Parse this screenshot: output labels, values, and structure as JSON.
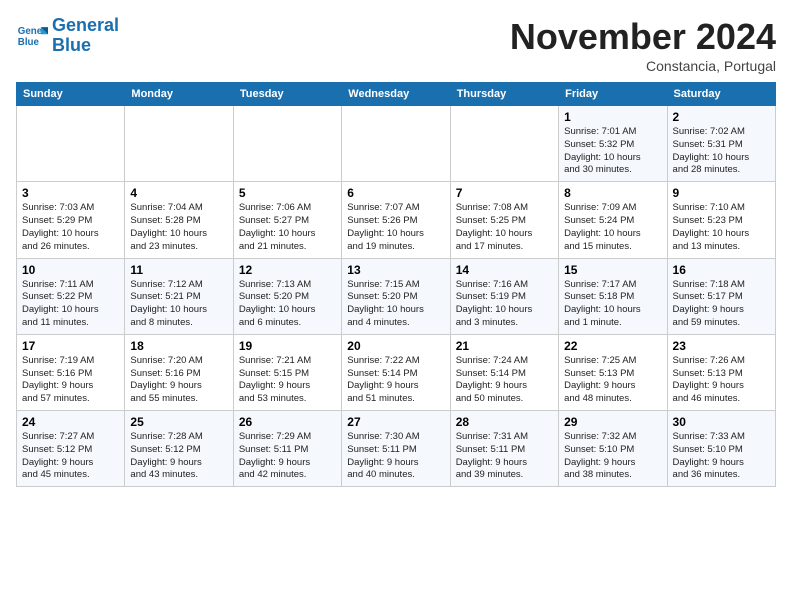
{
  "header": {
    "logo_line1": "General",
    "logo_line2": "Blue",
    "month_title": "November 2024",
    "subtitle": "Constancia, Portugal"
  },
  "weekdays": [
    "Sunday",
    "Monday",
    "Tuesday",
    "Wednesday",
    "Thursday",
    "Friday",
    "Saturday"
  ],
  "weeks": [
    [
      {
        "day": "",
        "info": ""
      },
      {
        "day": "",
        "info": ""
      },
      {
        "day": "",
        "info": ""
      },
      {
        "day": "",
        "info": ""
      },
      {
        "day": "",
        "info": ""
      },
      {
        "day": "1",
        "info": "Sunrise: 7:01 AM\nSunset: 5:32 PM\nDaylight: 10 hours\nand 30 minutes."
      },
      {
        "day": "2",
        "info": "Sunrise: 7:02 AM\nSunset: 5:31 PM\nDaylight: 10 hours\nand 28 minutes."
      }
    ],
    [
      {
        "day": "3",
        "info": "Sunrise: 7:03 AM\nSunset: 5:29 PM\nDaylight: 10 hours\nand 26 minutes."
      },
      {
        "day": "4",
        "info": "Sunrise: 7:04 AM\nSunset: 5:28 PM\nDaylight: 10 hours\nand 23 minutes."
      },
      {
        "day": "5",
        "info": "Sunrise: 7:06 AM\nSunset: 5:27 PM\nDaylight: 10 hours\nand 21 minutes."
      },
      {
        "day": "6",
        "info": "Sunrise: 7:07 AM\nSunset: 5:26 PM\nDaylight: 10 hours\nand 19 minutes."
      },
      {
        "day": "7",
        "info": "Sunrise: 7:08 AM\nSunset: 5:25 PM\nDaylight: 10 hours\nand 17 minutes."
      },
      {
        "day": "8",
        "info": "Sunrise: 7:09 AM\nSunset: 5:24 PM\nDaylight: 10 hours\nand 15 minutes."
      },
      {
        "day": "9",
        "info": "Sunrise: 7:10 AM\nSunset: 5:23 PM\nDaylight: 10 hours\nand 13 minutes."
      }
    ],
    [
      {
        "day": "10",
        "info": "Sunrise: 7:11 AM\nSunset: 5:22 PM\nDaylight: 10 hours\nand 11 minutes."
      },
      {
        "day": "11",
        "info": "Sunrise: 7:12 AM\nSunset: 5:21 PM\nDaylight: 10 hours\nand 8 minutes."
      },
      {
        "day": "12",
        "info": "Sunrise: 7:13 AM\nSunset: 5:20 PM\nDaylight: 10 hours\nand 6 minutes."
      },
      {
        "day": "13",
        "info": "Sunrise: 7:15 AM\nSunset: 5:20 PM\nDaylight: 10 hours\nand 4 minutes."
      },
      {
        "day": "14",
        "info": "Sunrise: 7:16 AM\nSunset: 5:19 PM\nDaylight: 10 hours\nand 3 minutes."
      },
      {
        "day": "15",
        "info": "Sunrise: 7:17 AM\nSunset: 5:18 PM\nDaylight: 10 hours\nand 1 minute."
      },
      {
        "day": "16",
        "info": "Sunrise: 7:18 AM\nSunset: 5:17 PM\nDaylight: 9 hours\nand 59 minutes."
      }
    ],
    [
      {
        "day": "17",
        "info": "Sunrise: 7:19 AM\nSunset: 5:16 PM\nDaylight: 9 hours\nand 57 minutes."
      },
      {
        "day": "18",
        "info": "Sunrise: 7:20 AM\nSunset: 5:16 PM\nDaylight: 9 hours\nand 55 minutes."
      },
      {
        "day": "19",
        "info": "Sunrise: 7:21 AM\nSunset: 5:15 PM\nDaylight: 9 hours\nand 53 minutes."
      },
      {
        "day": "20",
        "info": "Sunrise: 7:22 AM\nSunset: 5:14 PM\nDaylight: 9 hours\nand 51 minutes."
      },
      {
        "day": "21",
        "info": "Sunrise: 7:24 AM\nSunset: 5:14 PM\nDaylight: 9 hours\nand 50 minutes."
      },
      {
        "day": "22",
        "info": "Sunrise: 7:25 AM\nSunset: 5:13 PM\nDaylight: 9 hours\nand 48 minutes."
      },
      {
        "day": "23",
        "info": "Sunrise: 7:26 AM\nSunset: 5:13 PM\nDaylight: 9 hours\nand 46 minutes."
      }
    ],
    [
      {
        "day": "24",
        "info": "Sunrise: 7:27 AM\nSunset: 5:12 PM\nDaylight: 9 hours\nand 45 minutes."
      },
      {
        "day": "25",
        "info": "Sunrise: 7:28 AM\nSunset: 5:12 PM\nDaylight: 9 hours\nand 43 minutes."
      },
      {
        "day": "26",
        "info": "Sunrise: 7:29 AM\nSunset: 5:11 PM\nDaylight: 9 hours\nand 42 minutes."
      },
      {
        "day": "27",
        "info": "Sunrise: 7:30 AM\nSunset: 5:11 PM\nDaylight: 9 hours\nand 40 minutes."
      },
      {
        "day": "28",
        "info": "Sunrise: 7:31 AM\nSunset: 5:11 PM\nDaylight: 9 hours\nand 39 minutes."
      },
      {
        "day": "29",
        "info": "Sunrise: 7:32 AM\nSunset: 5:10 PM\nDaylight: 9 hours\nand 38 minutes."
      },
      {
        "day": "30",
        "info": "Sunrise: 7:33 AM\nSunset: 5:10 PM\nDaylight: 9 hours\nand 36 minutes."
      }
    ]
  ]
}
